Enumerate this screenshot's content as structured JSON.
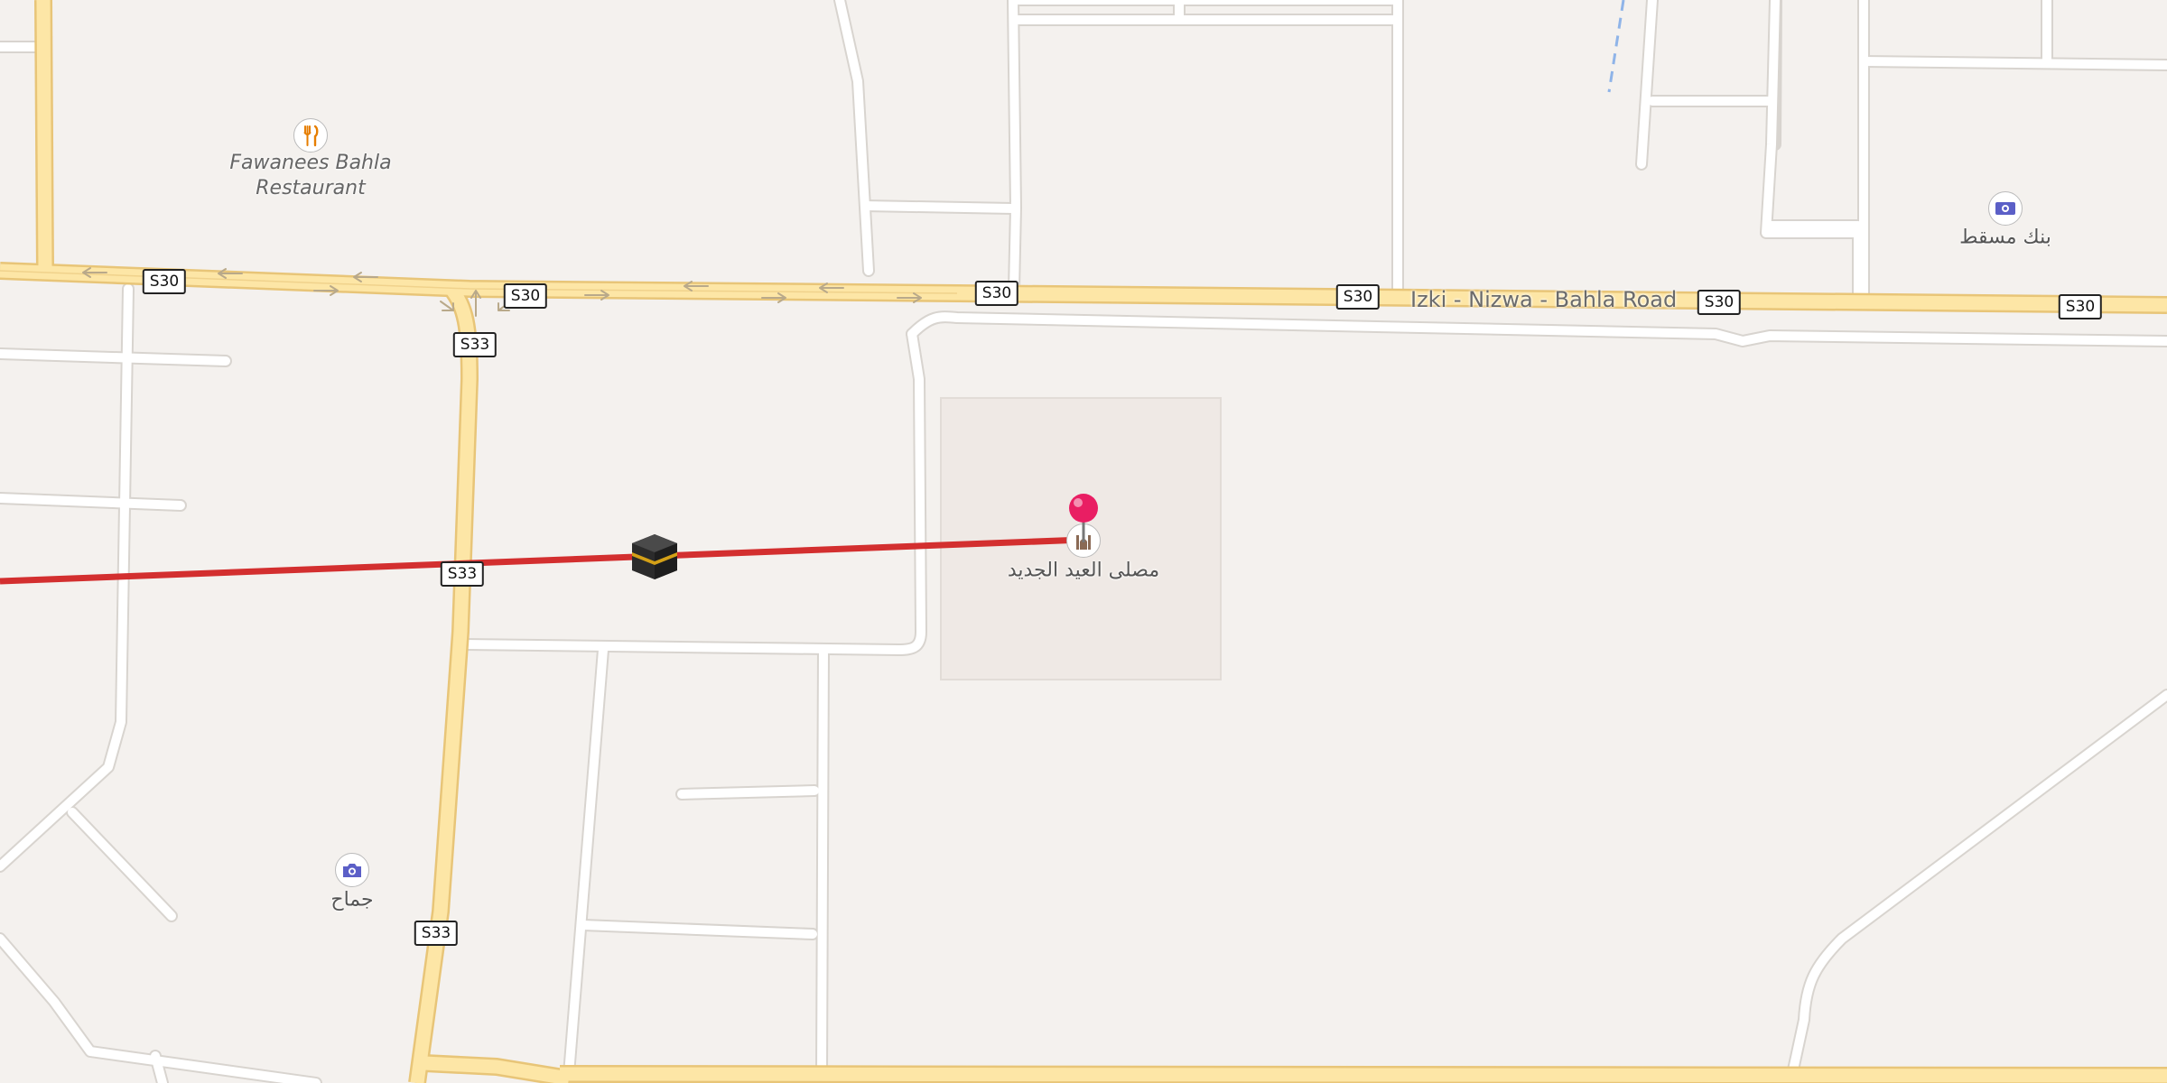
{
  "map": {
    "roads": {
      "main_road_name": "Izki - Nizwa - Bahla Road",
      "route_shields": [
        {
          "id": "s30-a",
          "label": "S30"
        },
        {
          "id": "s30-b",
          "label": "S30"
        },
        {
          "id": "s30-c",
          "label": "S30"
        },
        {
          "id": "s30-d",
          "label": "S30"
        },
        {
          "id": "s30-e",
          "label": "S30"
        },
        {
          "id": "s30-f",
          "label": "S30"
        },
        {
          "id": "s33-a",
          "label": "S33"
        },
        {
          "id": "s33-b",
          "label": "S33"
        },
        {
          "id": "s33-c",
          "label": "S33"
        }
      ]
    },
    "places": {
      "restaurant": {
        "name_line1": "Fawanees Bahla",
        "name_line2": "Restaurant",
        "icon": "fork-knife-icon"
      },
      "bank": {
        "name": "بنك مسقط",
        "icon": "banknote-icon"
      },
      "mosque": {
        "name": "مصلى العيد الجديد",
        "icon": "mosque-icon"
      },
      "photo_spot": {
        "name": "جماح",
        "icon": "camera-icon"
      }
    },
    "markers": {
      "pin": {
        "icon": "pink-pin-icon"
      },
      "kaaba": {
        "icon": "kaaba-icon"
      },
      "qibla_line_color": "#d32f2f"
    },
    "colors": {
      "background": "#f4f1ee",
      "major_road": "#fde6a6",
      "major_road_casing": "#e8c578",
      "minor_road": "#ffffff",
      "minor_road_casing": "#d8d4cf",
      "landuse": "#efe9e5"
    }
  }
}
